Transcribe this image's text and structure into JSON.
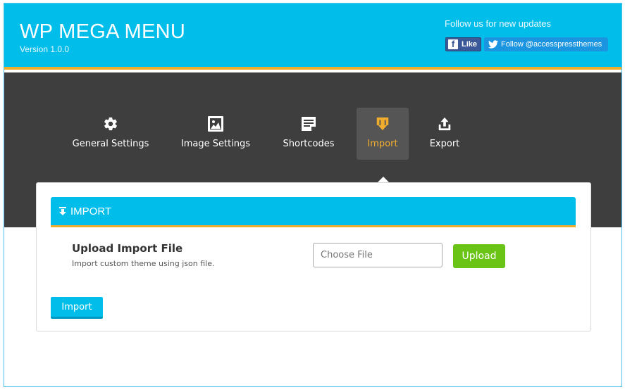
{
  "header": {
    "title": "WP MEGA MENU",
    "version": "Version 1.0.0",
    "follow_text": "Follow us for new updates",
    "facebook_label": "Like",
    "twitter_label": "Follow @accesspressthemes"
  },
  "tabs": [
    {
      "label": "General Settings",
      "icon": "gear-icon"
    },
    {
      "label": "Image Settings",
      "icon": "image-icon"
    },
    {
      "label": "Shortcodes",
      "icon": "document-icon"
    },
    {
      "label": "Import",
      "icon": "import-icon",
      "active": true
    },
    {
      "label": "Export",
      "icon": "export-icon"
    }
  ],
  "panel": {
    "title": "IMPORT",
    "upload_title": "Upload Import File",
    "upload_description": "Import custom theme using json file.",
    "file_placeholder": "Choose File",
    "upload_label": "Upload",
    "import_label": "Import"
  },
  "colors": {
    "brand": "#00bdea",
    "accent": "#f0ad2d",
    "dark": "#3e3e3e",
    "upload": "#6ac416"
  }
}
